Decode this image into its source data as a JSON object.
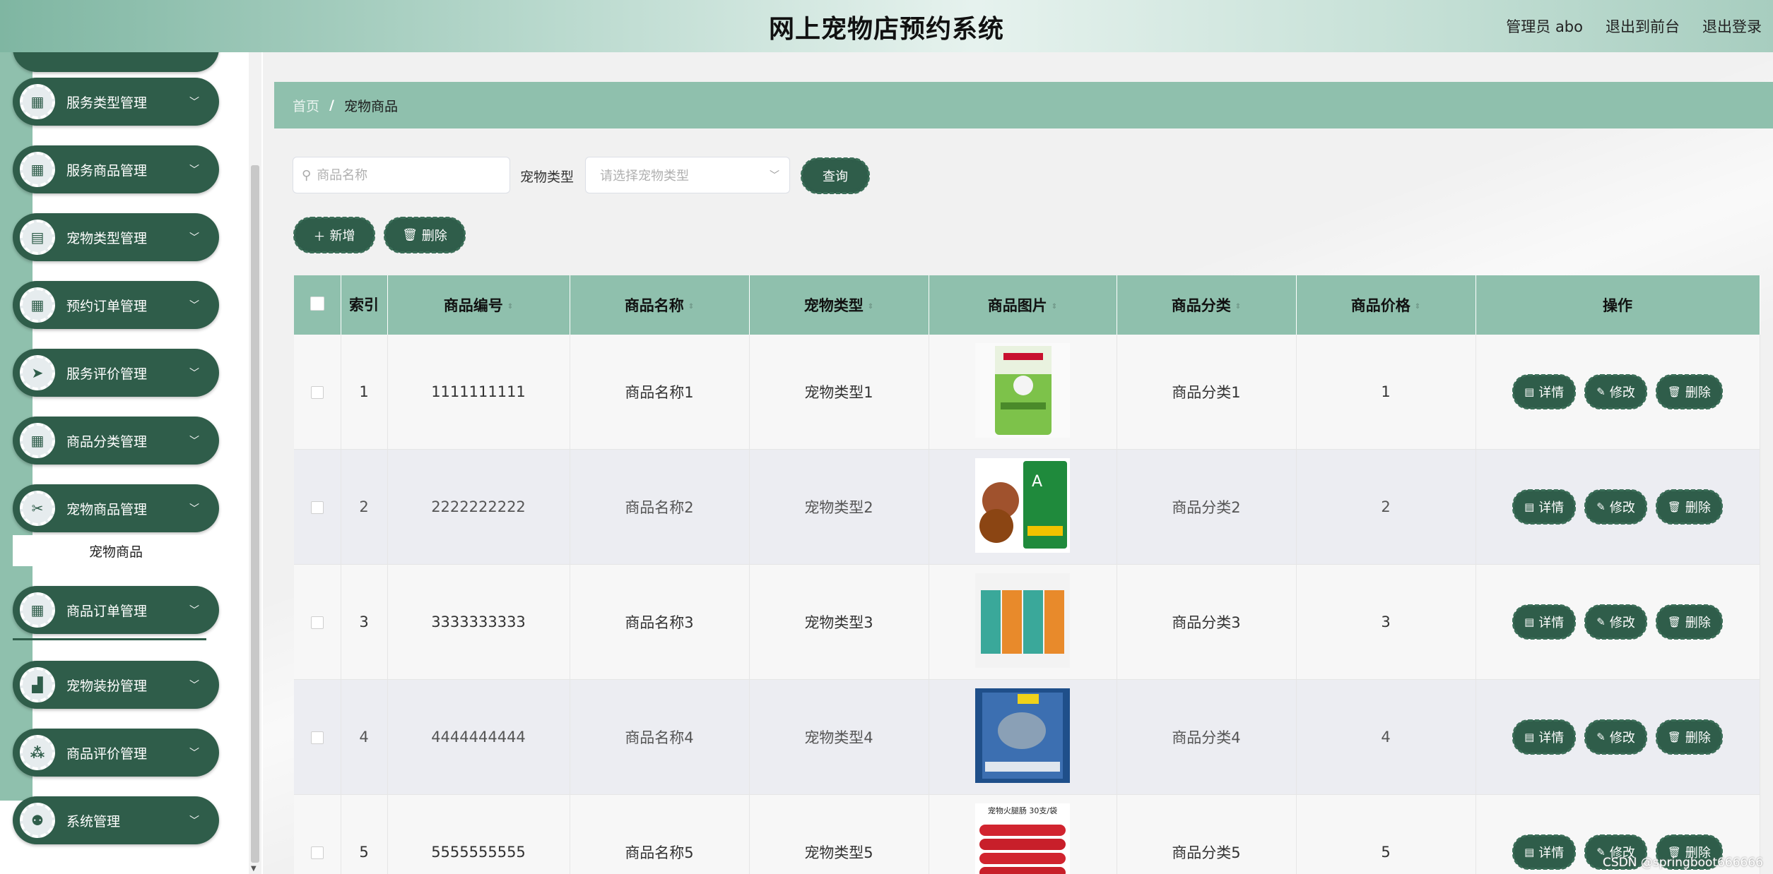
{
  "header": {
    "title": "网上宠物店预约系统",
    "user": "管理员 abo",
    "to_front": "退出到前台",
    "logout": "退出登录"
  },
  "sidebar": {
    "items": [
      {
        "label": "服务类型管理",
        "icon": "grid-icon"
      },
      {
        "label": "服务商品管理",
        "icon": "grid-icon"
      },
      {
        "label": "宠物类型管理",
        "icon": "clipboard-icon"
      },
      {
        "label": "预约订单管理",
        "icon": "grid-icon"
      },
      {
        "label": "服务评价管理",
        "icon": "send-icon"
      },
      {
        "label": "商品分类管理",
        "icon": "grid-icon"
      },
      {
        "label": "宠物商品管理",
        "icon": "scissors-icon"
      },
      {
        "label": "商品订单管理",
        "icon": "grid-icon"
      },
      {
        "label": "宠物装扮管理",
        "icon": "chart-icon"
      },
      {
        "label": "商品评价管理",
        "icon": "apps-icon"
      },
      {
        "label": "系统管理",
        "icon": "user-icon"
      }
    ],
    "sub_active": "宠物商品"
  },
  "breadcrumb": {
    "home": "首页",
    "separator": "/",
    "current": "宠物商品"
  },
  "search": {
    "name_placeholder": "商品名称",
    "pet_type_label": "宠物类型",
    "pet_type_placeholder": "请选择宠物类型",
    "query_button": "查询"
  },
  "actions": {
    "add": "新增",
    "delete": "删除"
  },
  "table": {
    "headers": [
      "索引",
      "商品编号",
      "商品名称",
      "宠物类型",
      "商品图片",
      "商品分类",
      "商品价格",
      "操作"
    ],
    "rows": [
      {
        "index": "1",
        "code": "1111111111",
        "name": "商品名称1",
        "pet_type": "宠物类型1",
        "category": "商品分类1",
        "price": "1"
      },
      {
        "index": "2",
        "code": "2222222222",
        "name": "商品名称2",
        "pet_type": "宠物类型2",
        "category": "商品分类2",
        "price": "2"
      },
      {
        "index": "3",
        "code": "3333333333",
        "name": "商品名称3",
        "pet_type": "宠物类型3",
        "category": "商品分类3",
        "price": "3"
      },
      {
        "index": "4",
        "code": "4444444444",
        "name": "商品名称4",
        "pet_type": "宠物类型4",
        "category": "商品分类4",
        "price": "4"
      },
      {
        "index": "5",
        "code": "5555555555",
        "name": "商品名称5",
        "pet_type": "宠物类型5",
        "category": "商品分类5",
        "price": "5"
      }
    ],
    "row_actions": {
      "detail": "详情",
      "edit": "修改",
      "delete": "删除"
    },
    "image5_caption": "宠物火腿肠 30支/袋"
  },
  "watermark": "CSDN @springboot666666",
  "colors": {
    "primary": "#2f5d4a",
    "accent": "#8fc0ad"
  }
}
